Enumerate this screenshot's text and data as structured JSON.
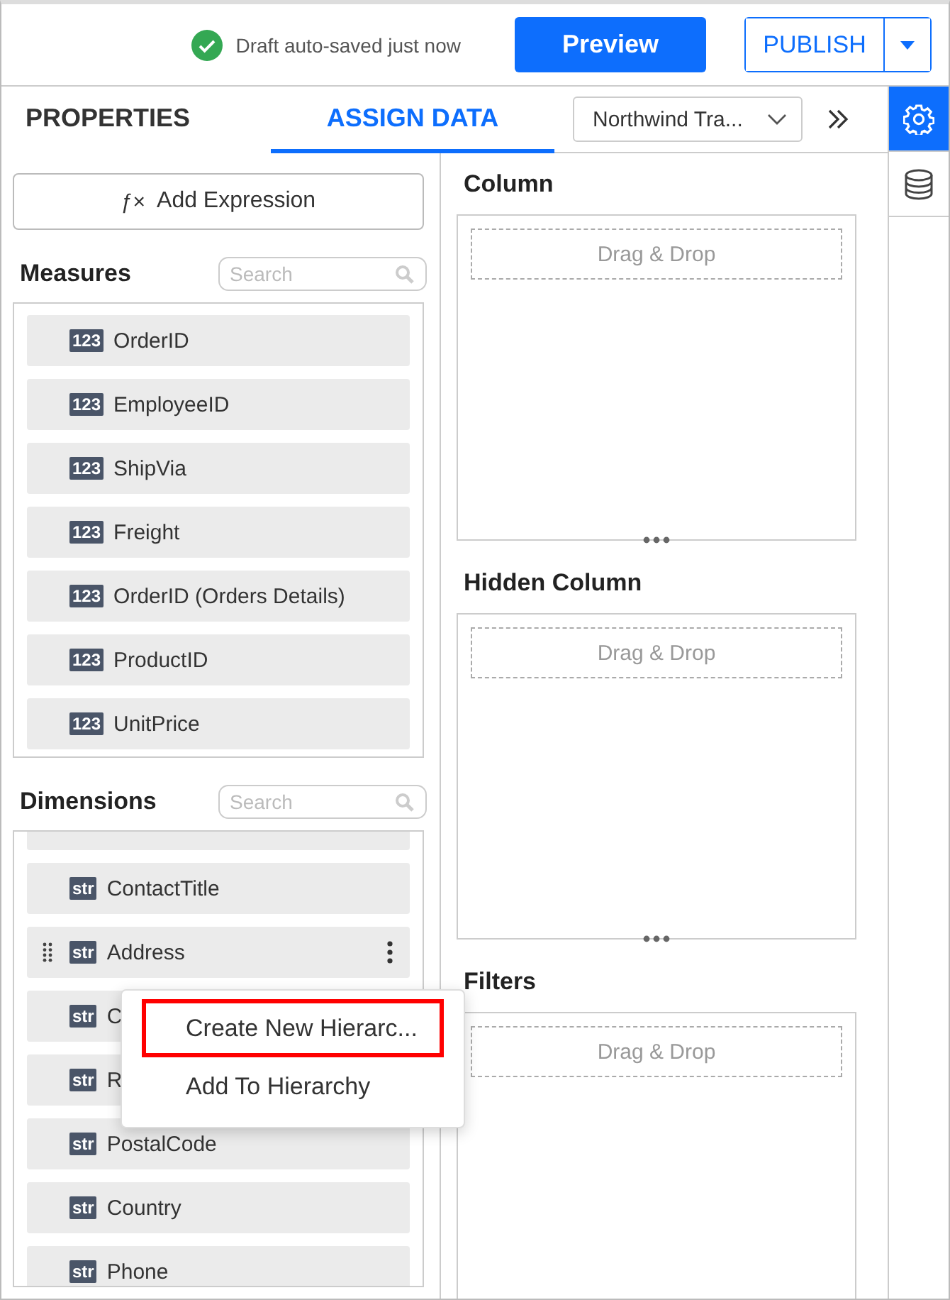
{
  "header": {
    "status": "Draft auto-saved just now",
    "preview_button": "Preview",
    "publish_button": "PUBLISH"
  },
  "tabs": [
    {
      "label": "PROPERTIES",
      "selected": false
    },
    {
      "label": "ASSIGN DATA",
      "selected": true
    }
  ],
  "datasource": {
    "value": "Northwind Tra..."
  },
  "side_icons": [
    {
      "kind": "settings",
      "selected": true
    },
    {
      "kind": "database",
      "selected": false
    }
  ],
  "add_expression": {
    "icon": "ƒ×",
    "label": "Add Expression"
  },
  "measures": {
    "title": "Measures",
    "placeholder": "Search",
    "items": [
      {
        "badge": "123",
        "label": "OrderID",
        "hovered": false
      },
      {
        "badge": "123",
        "label": "EmployeeID",
        "hovered": false
      },
      {
        "badge": "123",
        "label": "ShipVia",
        "hovered": false
      },
      {
        "badge": "123",
        "label": "Freight",
        "hovered": false
      },
      {
        "badge": "123",
        "label": "OrderID (Orders Details)",
        "hovered": false
      },
      {
        "badge": "123",
        "label": "ProductID",
        "hovered": false
      },
      {
        "badge": "123",
        "label": "UnitPrice",
        "hovered": false
      }
    ]
  },
  "dimensions": {
    "title": "Dimensions",
    "placeholder": "Search",
    "scrolled_past": true,
    "items": [
      {
        "badge": "str",
        "label": "ContactTitle",
        "hovered": false
      },
      {
        "badge": "str",
        "label": "Address",
        "hovered": true
      },
      {
        "badge": "str",
        "label": "C",
        "hovered": false
      },
      {
        "badge": "str",
        "label": "R",
        "hovered": false
      },
      {
        "badge": "str",
        "label": "PostalCode",
        "hovered": false
      },
      {
        "badge": "str",
        "label": "Country",
        "hovered": false
      },
      {
        "badge": "str",
        "label": "Phone",
        "hovered": false
      }
    ]
  },
  "context_menu": {
    "items": [
      {
        "label": "Create New Hierarc...",
        "highlighted": true
      },
      {
        "label": "Add To Hierarchy",
        "highlighted": false
      }
    ]
  },
  "drop_zones": [
    {
      "title": "Column",
      "hint": "Drag & Drop"
    },
    {
      "title": "Hidden Column",
      "hint": "Drag & Drop"
    },
    {
      "title": "Filters",
      "hint": "Drag & Drop"
    }
  ]
}
